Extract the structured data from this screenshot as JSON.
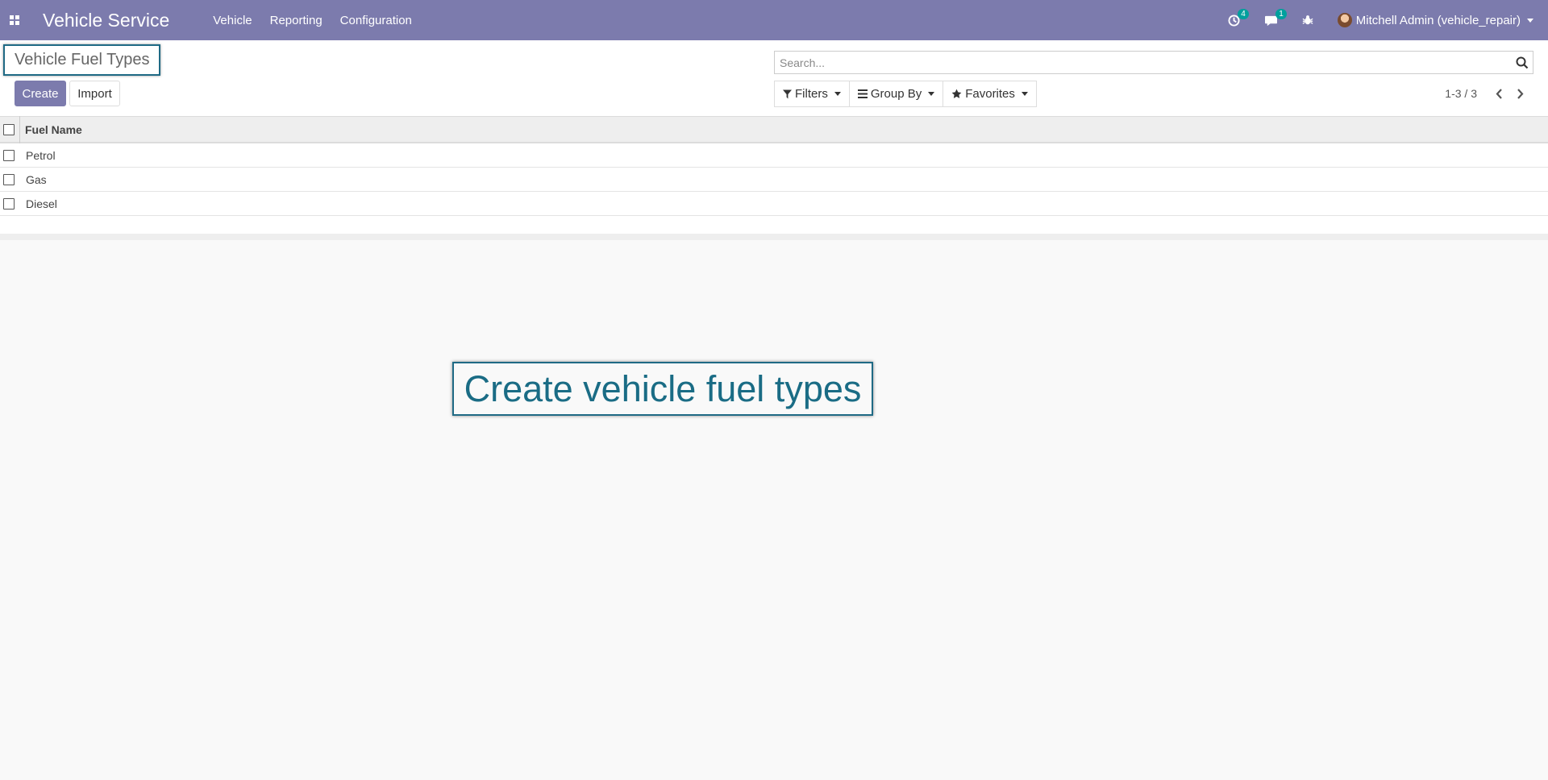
{
  "navbar": {
    "app_title": "Vehicle Service",
    "menu": [
      "Vehicle",
      "Reporting",
      "Configuration"
    ],
    "activity_count": "4",
    "message_count": "1",
    "user_label": "Mitchell Admin (vehicle_repair)"
  },
  "control_panel": {
    "breadcrumb_title": "Vehicle Fuel Types",
    "create_label": "Create",
    "import_label": "Import",
    "search_placeholder": "Search...",
    "filters_label": "Filters",
    "groupby_label": "Group By",
    "favorites_label": "Favorites",
    "pager_value": "1-3 / 3"
  },
  "table": {
    "column_header": "Fuel Name",
    "rows": [
      "Petrol",
      "Gas",
      "Diesel"
    ]
  },
  "callout": {
    "text": "Create vehicle fuel types"
  },
  "colors": {
    "brand": "#7c7bad",
    "badge": "#00a09d",
    "callout": "#1a6c85"
  }
}
